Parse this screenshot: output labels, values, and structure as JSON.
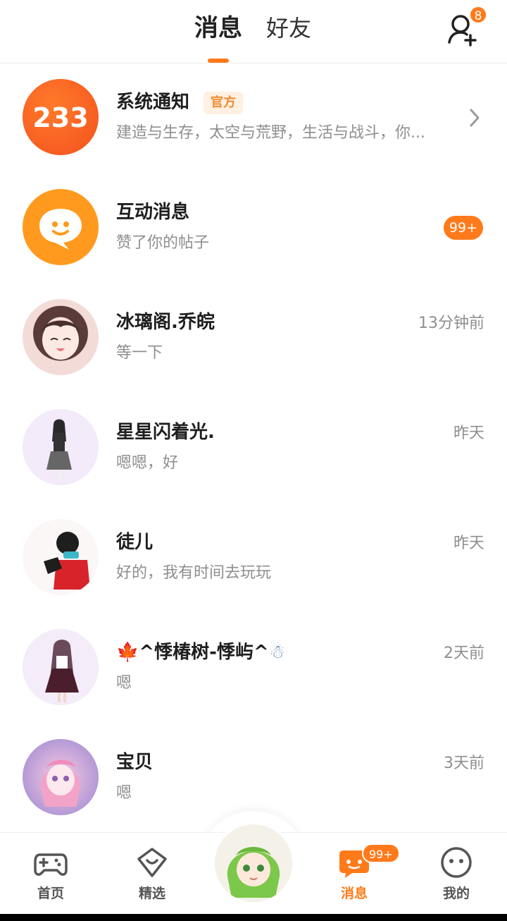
{
  "header": {
    "tabs": [
      {
        "label": "消息",
        "active": true
      },
      {
        "label": "好友",
        "active": false
      }
    ],
    "friend_request_count": "8"
  },
  "conversations": [
    {
      "name": "系统通知",
      "tag": "官方",
      "preview": "建造与生存，太空与荒野，生活与战斗，你...",
      "avatar_text": "233",
      "trailing": "chevron"
    },
    {
      "name": "互动消息",
      "preview": "赞了你的帖子",
      "unread": "99+"
    },
    {
      "name": "冰璃阁.乔皖",
      "preview": "等一下",
      "time": "13分钟前"
    },
    {
      "name": "星星闪着光.",
      "preview": "嗯嗯，好",
      "time": "昨天"
    },
    {
      "name": "徒儿",
      "preview": "好的，我有时间去玩玩",
      "time": "昨天"
    },
    {
      "name": "^悸椿树-悸屿^",
      "name_prefix_emoji": "🍁",
      "name_suffix_emoji": "☃",
      "preview": "嗯",
      "time": "2天前"
    },
    {
      "name": "宝贝",
      "preview": "嗯",
      "time": "3天前"
    }
  ],
  "bottom_nav": {
    "items": [
      {
        "label": "首页",
        "icon": "gamepad-icon",
        "active": false
      },
      {
        "label": "精选",
        "icon": "heart-diamond-icon",
        "active": false
      },
      {
        "label": "消息",
        "icon": "chat-bubble-icon",
        "active": true,
        "badge": "99+"
      },
      {
        "label": "我的",
        "icon": "smiley-face-icon",
        "active": false
      }
    ]
  },
  "colors": {
    "accent": "#ff7a1a",
    "text_primary": "#1e1e1e",
    "text_secondary": "#8e8e8e",
    "official_tag_bg": "#fff0e2",
    "official_tag_text": "#f08a2e"
  }
}
